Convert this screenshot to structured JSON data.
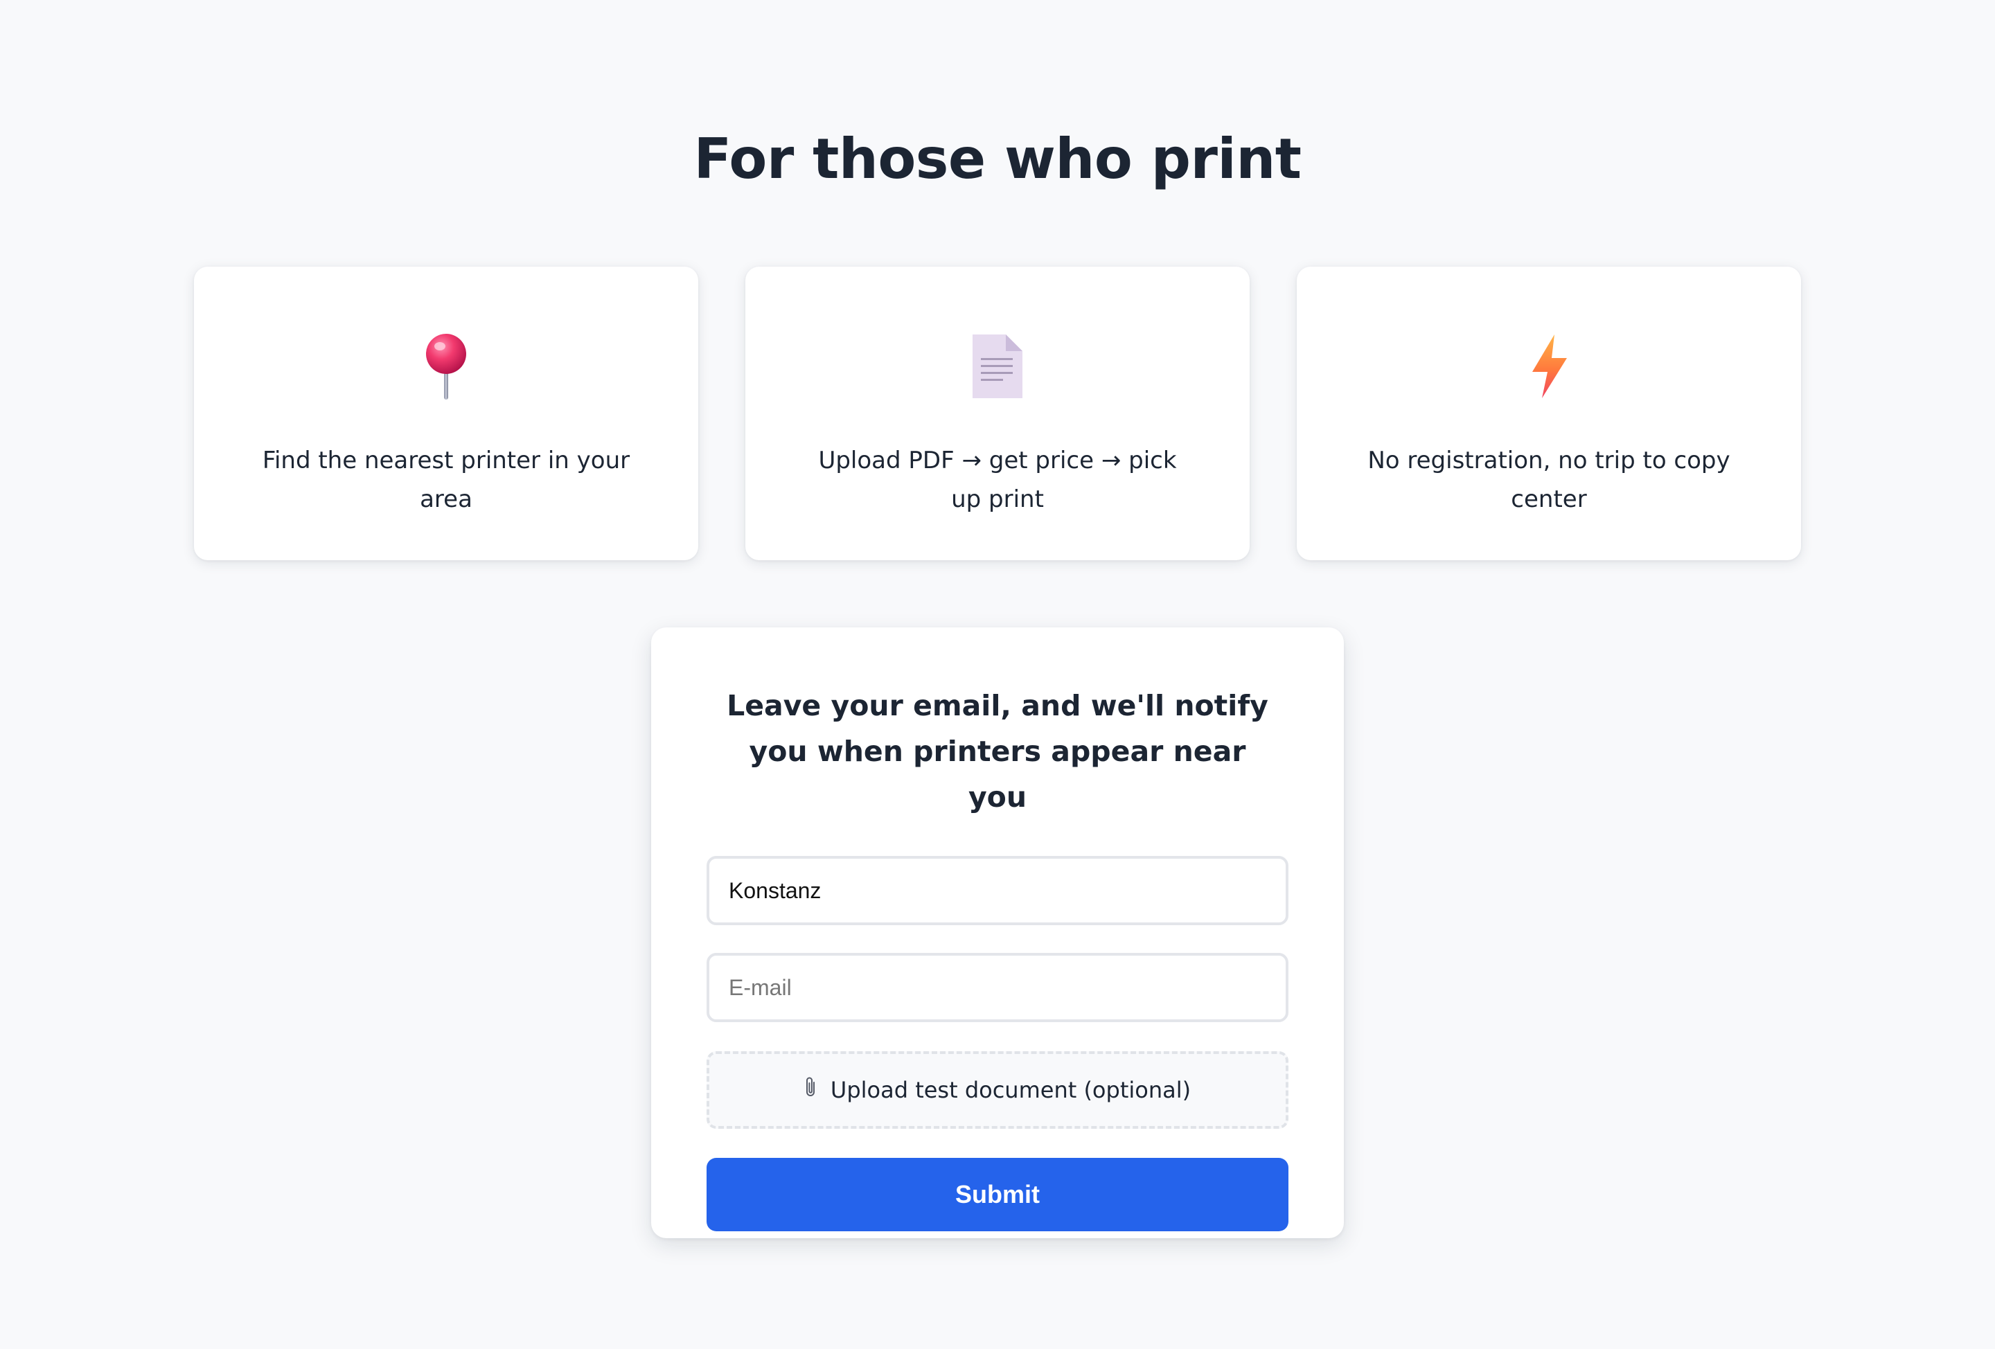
{
  "page_title": "For those who print",
  "features": [
    {
      "icon": "pushpin-icon",
      "text": "Find the nearest printer in your area"
    },
    {
      "icon": "document-icon",
      "text": "Upload PDF → get price → pick up print"
    },
    {
      "icon": "lightning-icon",
      "text": "No registration, no trip to copy center"
    }
  ],
  "signup": {
    "heading": "Leave your email, and we'll notify you when printers appear near you",
    "city_value": "Konstanz",
    "email_placeholder": "E-mail",
    "upload_icon": "paperclip-icon",
    "upload_label": "Upload test document (optional)",
    "submit_label": "Submit"
  },
  "colors": {
    "background": "#f8f9fb",
    "primary_button": "#2563eb",
    "text": "#1c2533"
  }
}
